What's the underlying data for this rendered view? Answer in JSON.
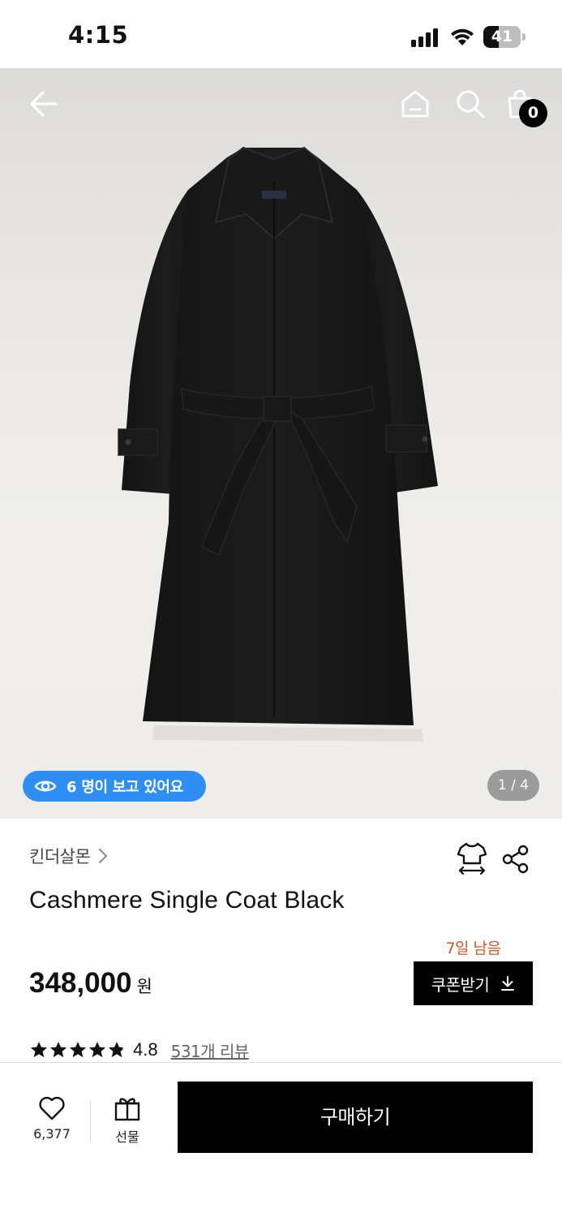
{
  "status_bar": {
    "time": "4:15",
    "battery": "41",
    "battery_level": 0.41
  },
  "header": {
    "back_icon": "arrow-left-icon",
    "home_icon": "home-icon",
    "search_icon": "search-icon",
    "cart_icon": "shopping-bag-icon",
    "cart_count": "0"
  },
  "gallery": {
    "viewers_text": "6 명이 보고 있어요",
    "viewers_icon": "eye-icon",
    "viewers_color": "#2f8ef4",
    "page_indicator": "1 / 4"
  },
  "product": {
    "brand": "킨더살몬",
    "title": "Cashmere Single Coat Black",
    "price": "348,000",
    "price_unit": "원",
    "rating": "4.8",
    "rating_stars": 4.8,
    "reviews": "531개 리뷰"
  },
  "coupon": {
    "remaining": "7일 남음",
    "remaining_color": "#d9552a",
    "button_label": "쿠폰받기",
    "button_icon": "download-icon"
  },
  "actions": {
    "size_icon": "size-guide-icon",
    "share_icon": "share-icon"
  },
  "bottom_bar": {
    "like_icon": "heart-icon",
    "like_count": "6,377",
    "gift_icon": "gift-icon",
    "gift_label": "선물",
    "buy_label": "구매하기"
  }
}
